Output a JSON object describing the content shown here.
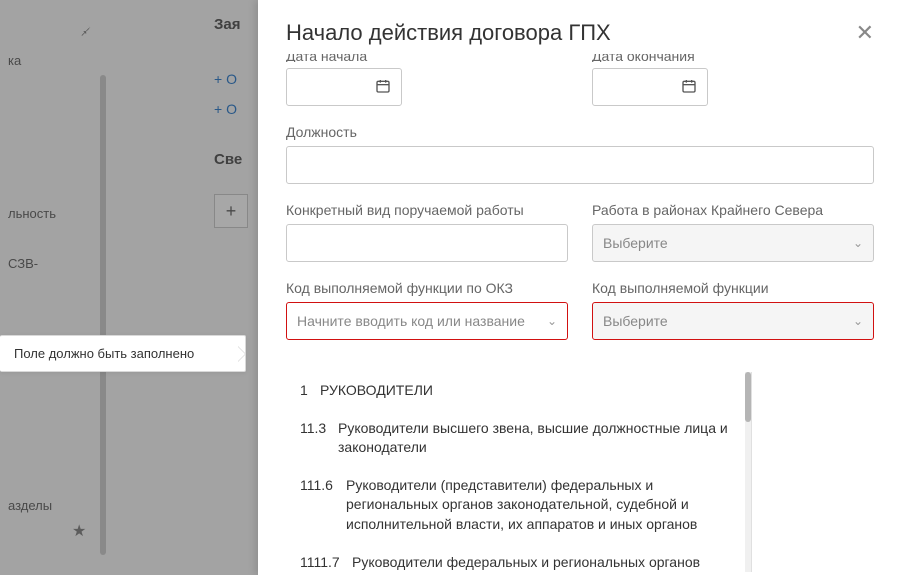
{
  "background": {
    "sidebar": {
      "item_truncated_1": "ка",
      "item_truncated_2": "льность",
      "item_truncated_3": "СЗВ-",
      "item_truncated_4": "азделы"
    },
    "main": {
      "title_truncated": "Зая",
      "link1_truncated": "О",
      "link2_truncated": "О",
      "section_title_truncated": "Све",
      "plus": "+"
    }
  },
  "tooltip": {
    "text": "Поле должно быть заполнено"
  },
  "modal": {
    "title": "Начало действия договора ГПХ",
    "date_start_label_cut": "Дата начала",
    "date_end_label_cut": "Дата окончания",
    "position_label": "Должность",
    "work_kind_label": "Конкретный вид поручаемой работы",
    "north_label": "Работа в районах Крайнего Севера",
    "north_placeholder": "Выберите",
    "okz_label": "Код выполняемой функции по ОКЗ",
    "okz_placeholder": "Начните вводить код или название",
    "func_label": "Код выполняемой функции",
    "func_placeholder": "Выберите"
  },
  "dropdown": {
    "items": [
      {
        "code": "1",
        "text": "РУКОВОДИТЕЛИ"
      },
      {
        "code": "11.3",
        "text": "Руководители высшего звена, высшие должностные лица и законодатели"
      },
      {
        "code": "111.6",
        "text": "Руководители (представители) федеральных и региональных органов законодательной, судебной и исполнительной власти, их аппаратов и иных органов"
      },
      {
        "code": "1111.7",
        "text": "Руководители федеральных и региональных органов"
      }
    ]
  }
}
